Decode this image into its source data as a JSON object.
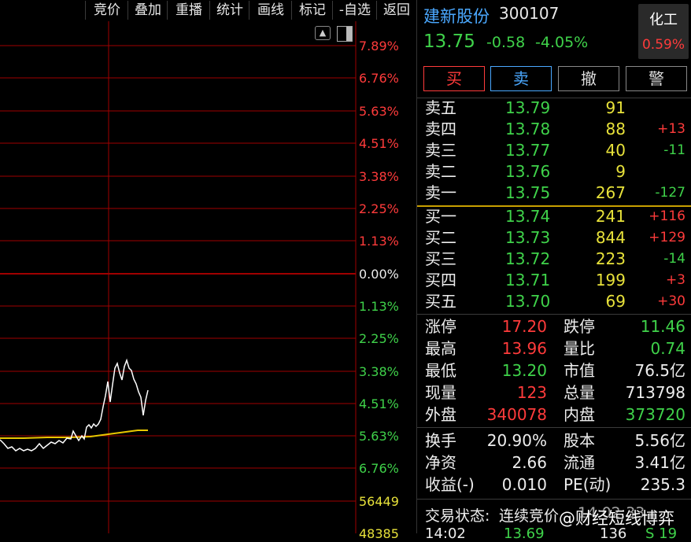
{
  "toolbar": {
    "buttons": [
      "竞价",
      "叠加",
      "重播",
      "统计",
      "画线",
      "标记",
      "-自选",
      "返回"
    ]
  },
  "chart": {
    "axis_labels": [
      "7.89%",
      "6.76%",
      "5.63%",
      "4.51%",
      "3.38%",
      "2.25%",
      "1.13%",
      "0.00%",
      "1.13%",
      "2.25%",
      "3.38%",
      "4.51%",
      "5.63%",
      "6.76%",
      "56449",
      "48385"
    ],
    "axis_colors": [
      "#ff3b3b",
      "#ff3b3b",
      "#ff3b3b",
      "#ff3b3b",
      "#ff3b3b",
      "#ff3b3b",
      "#ff3b3b",
      "#ededed",
      "#3fd24a",
      "#3fd24a",
      "#3fd24a",
      "#3fd24a",
      "#3fd24a",
      "#3fd24a",
      "#e8e23a",
      "#e8e23a"
    ]
  },
  "stock": {
    "name": "建新股份",
    "code": "300107",
    "price": "13.75",
    "change": "-0.58",
    "change_pct": "-4.05%",
    "sector": "化工",
    "sector_pct": "0.59%"
  },
  "trade_buttons": {
    "buy": "买",
    "sell": "卖",
    "cancel": "撤",
    "alert": "警"
  },
  "sell_orders": [
    {
      "label": "卖五",
      "price": "13.79",
      "volume": "91",
      "delta": ""
    },
    {
      "label": "卖四",
      "price": "13.78",
      "volume": "88",
      "delta": "+13"
    },
    {
      "label": "卖三",
      "price": "13.77",
      "volume": "40",
      "delta": "-11"
    },
    {
      "label": "卖二",
      "price": "13.76",
      "volume": "9",
      "delta": ""
    },
    {
      "label": "卖一",
      "price": "13.75",
      "volume": "267",
      "delta": "-127"
    }
  ],
  "buy_orders": [
    {
      "label": "买一",
      "price": "13.74",
      "volume": "241",
      "delta": "+116"
    },
    {
      "label": "买二",
      "price": "13.73",
      "volume": "844",
      "delta": "+129"
    },
    {
      "label": "买三",
      "price": "13.72",
      "volume": "223",
      "delta": "-14"
    },
    {
      "label": "买四",
      "price": "13.71",
      "volume": "199",
      "delta": "+3"
    },
    {
      "label": "买五",
      "price": "13.70",
      "volume": "69",
      "delta": "+30"
    }
  ],
  "stats": [
    {
      "l1": "涨停",
      "v1": "17.20",
      "l2": "跌停",
      "v2": "11.46"
    },
    {
      "l1": "最高",
      "v1": "13.96",
      "l2": "量比",
      "v2": "0.74"
    },
    {
      "l1": "最低",
      "v1": "13.20",
      "l2": "市值",
      "v2": "76.5亿"
    },
    {
      "l1": "现量",
      "v1": "123",
      "l2": "总量",
      "v2": "713798"
    },
    {
      "l1": "外盘",
      "v1": "340078",
      "l2": "内盘",
      "v2": "373720"
    }
  ],
  "fundamentals": [
    {
      "l1": "换手",
      "v1": "20.90%",
      "l2": "股本",
      "v2": "5.56亿"
    },
    {
      "l1": "净资",
      "v1": "2.66",
      "l2": "流通",
      "v2": "3.41亿"
    },
    {
      "l1": "收益(-)",
      "v1": "0.010",
      "l2": "PE(动)",
      "v2": "235.3"
    }
  ],
  "status": {
    "label": "交易状态:",
    "value": "连续竞价",
    "time": "14:02:33",
    "watermark": "@财经短线博弈"
  },
  "bottom_row": {
    "time": "14:02",
    "price": "13.69",
    "vol": "136",
    "extra": "S 19"
  }
}
